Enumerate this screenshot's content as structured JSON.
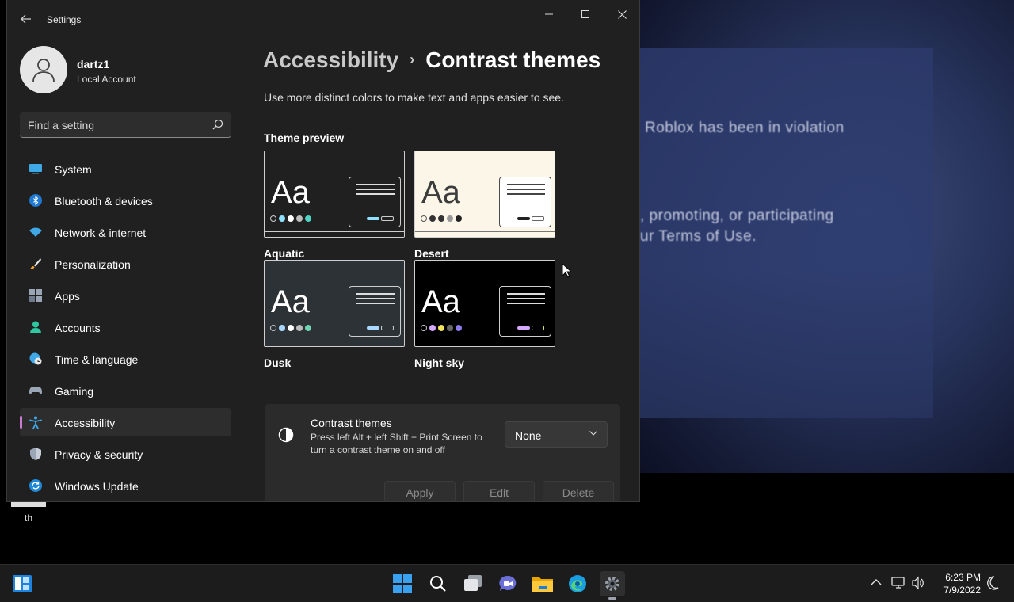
{
  "window": {
    "app_title": "Settings"
  },
  "profile": {
    "name": "dartz1",
    "account_type": "Local Account"
  },
  "search": {
    "placeholder": "Find a setting"
  },
  "sidebar": {
    "items": [
      {
        "label": "System",
        "icon": "system-icon"
      },
      {
        "label": "Bluetooth & devices",
        "icon": "bluetooth-icon"
      },
      {
        "label": "Network & internet",
        "icon": "wifi-icon"
      },
      {
        "label": "Personalization",
        "icon": "brush-icon"
      },
      {
        "label": "Apps",
        "icon": "apps-icon"
      },
      {
        "label": "Accounts",
        "icon": "accounts-icon"
      },
      {
        "label": "Time & language",
        "icon": "globe-clock-icon"
      },
      {
        "label": "Gaming",
        "icon": "gamepad-icon"
      },
      {
        "label": "Accessibility",
        "icon": "accessibility-icon",
        "active": true
      },
      {
        "label": "Privacy & security",
        "icon": "shield-icon"
      },
      {
        "label": "Windows Update",
        "icon": "update-icon"
      }
    ]
  },
  "main": {
    "breadcrumb_parent": "Accessibility",
    "breadcrumb_sep": "›",
    "page_title": "Contrast themes",
    "description": "Use more distinct colors to make text and apps easier to see.",
    "preview_title": "Theme preview",
    "themes": [
      {
        "name": "Aquatic",
        "sample": "Aa"
      },
      {
        "name": "Desert",
        "sample": "Aa"
      },
      {
        "name": "Dusk",
        "sample": "Aa"
      },
      {
        "name": "Night sky",
        "sample": "Aa"
      }
    ],
    "setting": {
      "title": "Contrast themes",
      "description": "Press left Alt + left Shift + Print Screen to turn a contrast theme on and off",
      "selected": "None",
      "apply_label": "Apply",
      "edit_label": "Edit",
      "delete_label": "Delete"
    }
  },
  "desktop": {
    "video_line1": "Roblox has been in violation",
    "video_line2": ", promoting, or participating",
    "video_line3": "ur Terms of Use.",
    "shortcut_label": "th"
  },
  "taskbar": {
    "time": "6:23 PM",
    "date": "7/9/2022",
    "accent": "#0078d4"
  }
}
